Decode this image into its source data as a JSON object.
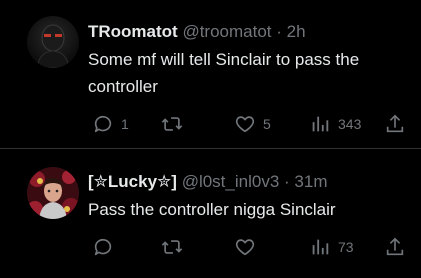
{
  "tweets": [
    {
      "display_name": "TRoomatot",
      "handle": "@troomatot",
      "separator": "·",
      "time": "2h",
      "text": "Some mf will tell Sinclair to pass the controller",
      "avatar_icon": "dark-masked-figure-avatar",
      "replies": "1",
      "retweets": "",
      "likes": "5",
      "views": "343"
    },
    {
      "display_name": "[✮Lucky✮]",
      "handle": "@l0st_inl0v3",
      "separator": "·",
      "time": "31m",
      "text": "Pass the controller nigga Sinclair",
      "avatar_icon": "red-floral-portrait-avatar",
      "replies": "",
      "retweets": "",
      "likes": "",
      "views": "73"
    }
  ],
  "colors": {
    "background": "#000000",
    "text": "#e7e9ea",
    "muted": "#71767b",
    "divider": "#2f3336"
  }
}
